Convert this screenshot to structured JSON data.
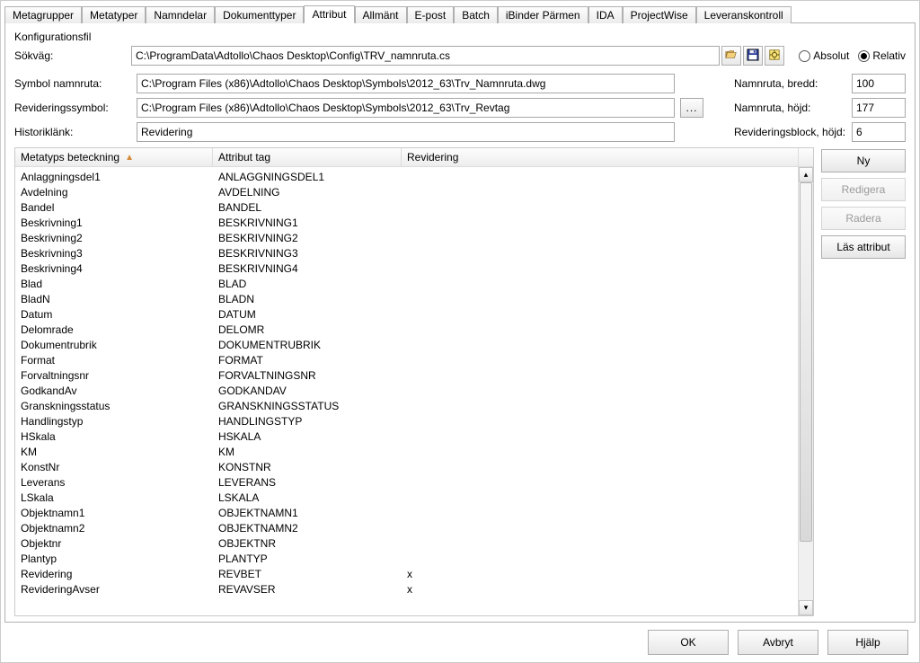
{
  "tabs": [
    "Metagrupper",
    "Metatyper",
    "Namndelar",
    "Dokumenttyper",
    "Attribut",
    "Allmänt",
    "E-post",
    "Batch",
    "iBinder Pärmen",
    "IDA",
    "ProjectWise",
    "Leveranskontroll"
  ],
  "activeTabIndex": 4,
  "config": {
    "section_label": "Konfigurationsfil",
    "path_label": "Sökväg:",
    "path_value": "C:\\ProgramData\\Adtollo\\Chaos Desktop\\Config\\TRV_namnruta.cs",
    "radio_absolut": "Absolut",
    "radio_relativ": "Relativ",
    "radio_selected": "Relativ"
  },
  "fields": {
    "symbol_label": "Symbol namnruta:",
    "symbol_value": "C:\\Program Files (x86)\\Adtollo\\Chaos Desktop\\Symbols\\2012_63\\Trv_Namnruta.dwg",
    "revsymbol_label": "Revideringssymbol:",
    "revsymbol_value": "C:\\Program Files (x86)\\Adtollo\\Chaos Desktop\\Symbols\\2012_63\\Trv_Revtag",
    "histlink_label": "Historiklänk:",
    "histlink_value": "Revidering",
    "width_label": "Namnruta, bredd:",
    "width_value": "100",
    "height_label": "Namnruta, höjd:",
    "height_value": "177",
    "revblock_label": "Revideringsblock, höjd:",
    "revblock_value": "6"
  },
  "table": {
    "columns": {
      "c0": "Metatyps beteckning",
      "c1": "Attribut tag",
      "c2": "Revidering"
    },
    "rows": [
      {
        "c0": "Anlaggningsdel1",
        "c1": "ANLAGGNINGSDEL1",
        "c2": ""
      },
      {
        "c0": "Avdelning",
        "c1": "AVDELNING",
        "c2": ""
      },
      {
        "c0": "Bandel",
        "c1": "BANDEL",
        "c2": ""
      },
      {
        "c0": "Beskrivning1",
        "c1": "BESKRIVNING1",
        "c2": ""
      },
      {
        "c0": "Beskrivning2",
        "c1": "BESKRIVNING2",
        "c2": ""
      },
      {
        "c0": "Beskrivning3",
        "c1": "BESKRIVNING3",
        "c2": ""
      },
      {
        "c0": "Beskrivning4",
        "c1": "BESKRIVNING4",
        "c2": ""
      },
      {
        "c0": "Blad",
        "c1": "BLAD",
        "c2": ""
      },
      {
        "c0": "BladN",
        "c1": "BLADN",
        "c2": ""
      },
      {
        "c0": "Datum",
        "c1": "DATUM",
        "c2": ""
      },
      {
        "c0": "Delomrade",
        "c1": "DELOMR",
        "c2": ""
      },
      {
        "c0": "Dokumentrubrik",
        "c1": "DOKUMENTRUBRIK",
        "c2": ""
      },
      {
        "c0": "Format",
        "c1": "FORMAT",
        "c2": ""
      },
      {
        "c0": "Forvaltningsnr",
        "c1": "FORVALTNINGSNR",
        "c2": ""
      },
      {
        "c0": "GodkandAv",
        "c1": "GODKANDAV",
        "c2": ""
      },
      {
        "c0": "Granskningsstatus",
        "c1": "GRANSKNINGSSTATUS",
        "c2": ""
      },
      {
        "c0": "Handlingstyp",
        "c1": "HANDLINGSTYP",
        "c2": ""
      },
      {
        "c0": "HSkala",
        "c1": "HSKALA",
        "c2": ""
      },
      {
        "c0": "KM",
        "c1": "KM",
        "c2": ""
      },
      {
        "c0": "KonstNr",
        "c1": "KONSTNR",
        "c2": ""
      },
      {
        "c0": "Leverans",
        "c1": "LEVERANS",
        "c2": ""
      },
      {
        "c0": "LSkala",
        "c1": "LSKALA",
        "c2": ""
      },
      {
        "c0": "Objektnamn1",
        "c1": "OBJEKTNAMN1",
        "c2": ""
      },
      {
        "c0": "Objektnamn2",
        "c1": "OBJEKTNAMN2",
        "c2": ""
      },
      {
        "c0": "Objektnr",
        "c1": "OBJEKTNR",
        "c2": ""
      },
      {
        "c0": "Plantyp",
        "c1": "PLANTYP",
        "c2": ""
      },
      {
        "c0": "Revidering",
        "c1": "REVBET",
        "c2": "x"
      },
      {
        "c0": "RevideringAvser",
        "c1": "REVAVSER",
        "c2": "x"
      }
    ]
  },
  "sideButtons": {
    "ny": "Ny",
    "redigera": "Redigera",
    "radera": "Radera",
    "las_attribut": "Läs attribut"
  },
  "footer": {
    "ok": "OK",
    "avbryt": "Avbryt",
    "hjalp_prefix": "H",
    "hjalp_mid": "j",
    "hjalp_suffix": "älp"
  },
  "icons": {
    "open": "open-icon",
    "save": "save-icon",
    "apply": "apply-icon",
    "browse": "browse-icon"
  }
}
